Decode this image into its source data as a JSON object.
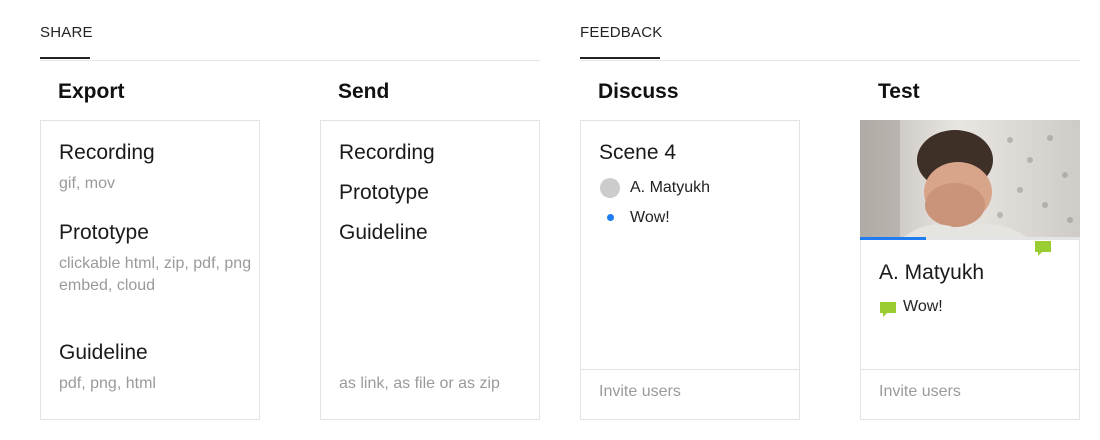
{
  "share": {
    "tab_label": "SHARE"
  },
  "feedback": {
    "tab_label": "FEEDBACK"
  },
  "export": {
    "title": "Export",
    "items": [
      {
        "title": "Recording",
        "sub": [
          "gif, mov"
        ]
      },
      {
        "title": "Prototype",
        "sub": [
          "clickable html, zip, pdf, png",
          "embed, cloud"
        ]
      },
      {
        "title": "Guideline",
        "sub": [
          "pdf, png, html"
        ]
      }
    ]
  },
  "send": {
    "title": "Send",
    "items": [
      "Recording",
      "Prototype",
      "Guideline"
    ],
    "footer_note": "as link, as file or as zip"
  },
  "discuss": {
    "title": "Discuss",
    "scene": "Scene 4",
    "author": "A. Matyukh",
    "comment": "Wow!",
    "footer": "Invite users"
  },
  "test": {
    "title": "Test",
    "author": "A. Matyukh",
    "comment": "Wow!",
    "progress": 0.3,
    "footer": "Invite users"
  },
  "colors": {
    "accent_blue": "#1e7bf0",
    "comment_green": "#9acd32",
    "muted_text": "#9a9a9a"
  }
}
